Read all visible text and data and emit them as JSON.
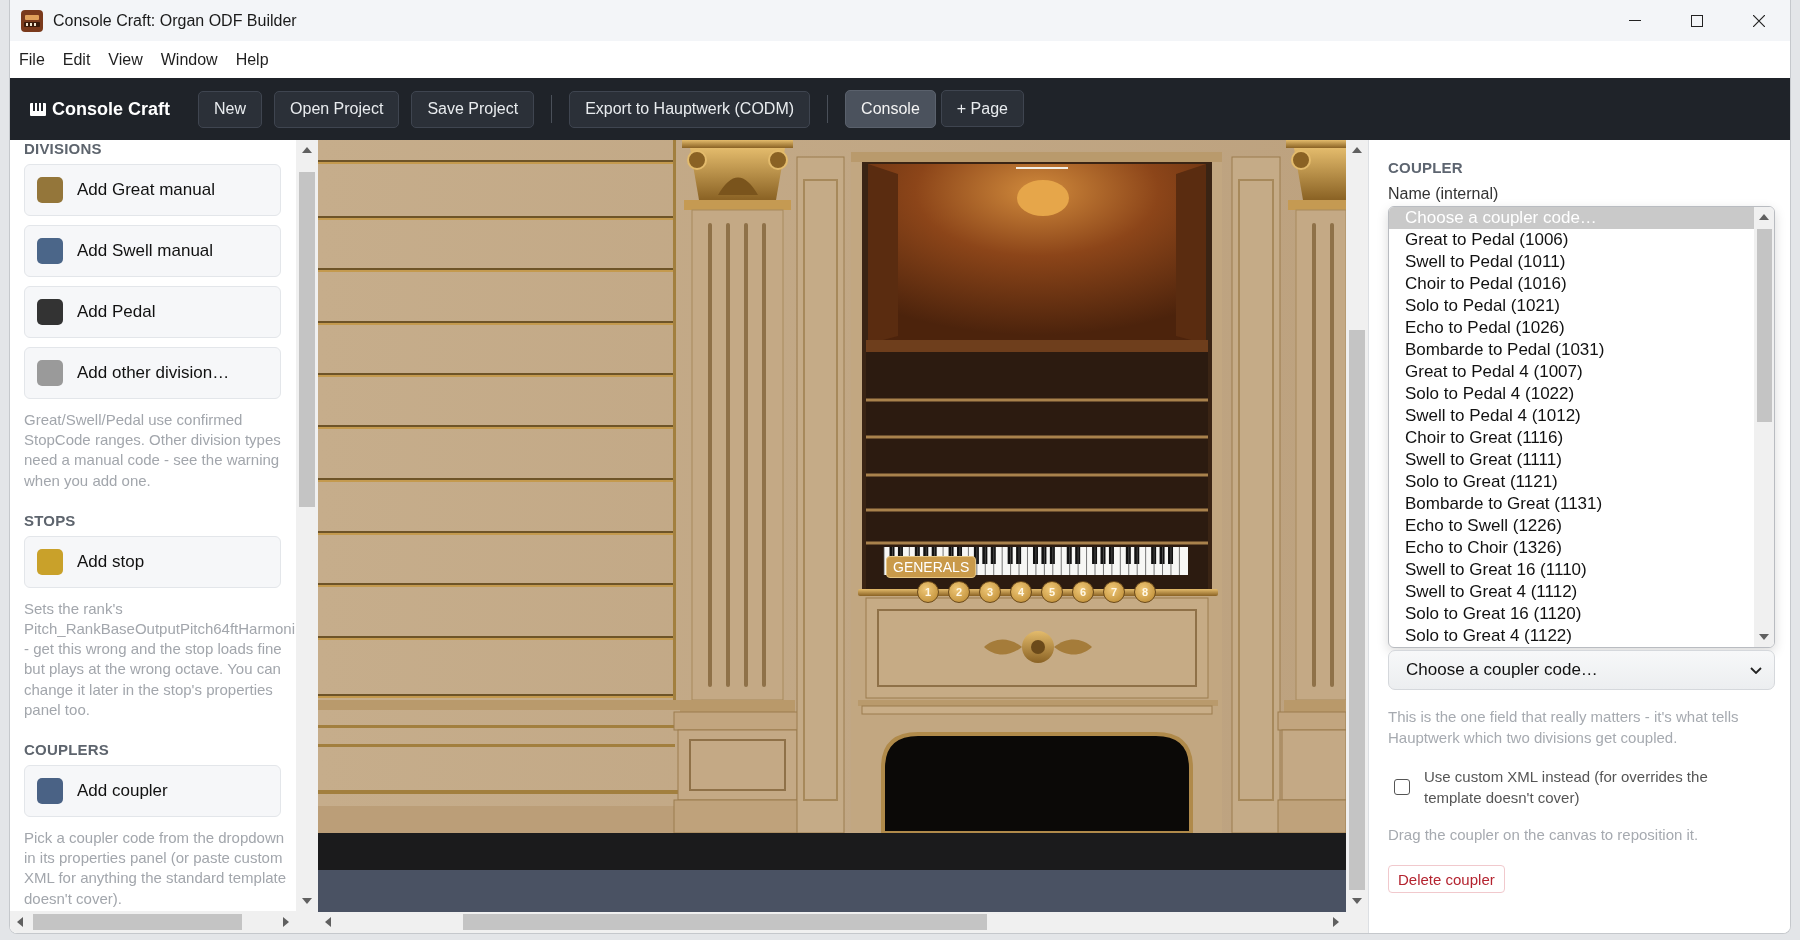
{
  "window": {
    "title": "Console Craft: Organ ODF Builder"
  },
  "menu": [
    {
      "label": "File"
    },
    {
      "label": "Edit"
    },
    {
      "label": "View"
    },
    {
      "label": "Window"
    },
    {
      "label": "Help"
    }
  ],
  "toolbar": {
    "brand": "Console Craft",
    "groups": [
      {
        "buttons": [
          {
            "label": "New",
            "selected": false
          },
          {
            "label": "Open Project",
            "selected": false
          },
          {
            "label": "Save Project",
            "selected": false
          }
        ]
      },
      {
        "buttons": [
          {
            "label": "Export to Hauptwerk (CODM)",
            "selected": false
          }
        ]
      },
      {
        "buttons": [
          {
            "label": "Console",
            "selected": true
          },
          {
            "label": "+ Page",
            "selected": false
          }
        ]
      }
    ]
  },
  "sidebar": {
    "sections": [
      {
        "heading": "DIVISIONS",
        "items": [
          {
            "label": "Add Great manual",
            "color": "#94763a"
          },
          {
            "label": "Add Swell manual",
            "color": "#4b6689"
          },
          {
            "label": "Add Pedal",
            "color": "#333333"
          },
          {
            "label": "Add other division…",
            "color": "#9a9a9a"
          }
        ],
        "note": "Great/Swell/Pedal use confirmed StopCode ranges. Other division types need a manual code - see the warning when you add one."
      },
      {
        "heading": "STOPS",
        "items": [
          {
            "label": "Add stop",
            "color": "#c9a12a"
          }
        ],
        "note": "Sets the rank's Pitch_RankBaseOutputPitch64ftHarmoni - get this wrong and the stop loads fine but plays at the wrong octave. You can change it later in the stop's properties panel too."
      },
      {
        "heading": "COUPLERS",
        "items": [
          {
            "label": "Add coupler",
            "color": "#4a6285"
          }
        ],
        "note": "Pick a coupler code from the dropdown in its properties panel (or paste custom XML for anything the standard template doesn't cover)."
      }
    ]
  },
  "canvas": {
    "generals_label": "GENERALS",
    "pistons": [
      "1",
      "2",
      "3",
      "4",
      "5",
      "6",
      "7",
      "8"
    ]
  },
  "properties": {
    "heading": "COUPLER",
    "name_label": "Name (internal)",
    "coupler_code": {
      "value": "Choose a coupler code…",
      "expanded": true,
      "options": [
        {
          "label": "Choose a coupler code…",
          "selected": true
        },
        {
          "label": "Great to Pedal (1006)",
          "selected": false
        },
        {
          "label": "Swell to Pedal (1011)",
          "selected": false
        },
        {
          "label": "Choir to Pedal (1016)",
          "selected": false
        },
        {
          "label": "Solo to Pedal (1021)",
          "selected": false
        },
        {
          "label": "Echo to Pedal (1026)",
          "selected": false
        },
        {
          "label": "Bombarde to Pedal (1031)",
          "selected": false
        },
        {
          "label": "Great to Pedal 4 (1007)",
          "selected": false
        },
        {
          "label": "Solo to Pedal 4 (1022)",
          "selected": false
        },
        {
          "label": "Swell to Pedal 4 (1012)",
          "selected": false
        },
        {
          "label": "Choir to Great (1116)",
          "selected": false
        },
        {
          "label": "Swell to Great (1111)",
          "selected": false
        },
        {
          "label": "Solo to Great (1121)",
          "selected": false
        },
        {
          "label": "Bombarde to Great (1131)",
          "selected": false
        },
        {
          "label": "Echo to Swell (1226)",
          "selected": false
        },
        {
          "label": "Echo to Choir (1326)",
          "selected": false
        },
        {
          "label": "Swell to Great 16 (1110)",
          "selected": false
        },
        {
          "label": "Swell to Great 4 (1112)",
          "selected": false
        },
        {
          "label": "Solo to Great 16 (1120)",
          "selected": false
        },
        {
          "label": "Solo to Great 4 (1122)",
          "selected": false
        }
      ]
    },
    "help": "This is the one field that really matters - it's what tells Hauptwerk which two divisions get coupled.",
    "custom_xml": {
      "label": "Use custom XML instead (for overrides the template doesn't cover)",
      "checked": false
    },
    "drag_hint": "Drag the coupler on the canvas to reposition it.",
    "delete_button": "Delete coupler"
  }
}
